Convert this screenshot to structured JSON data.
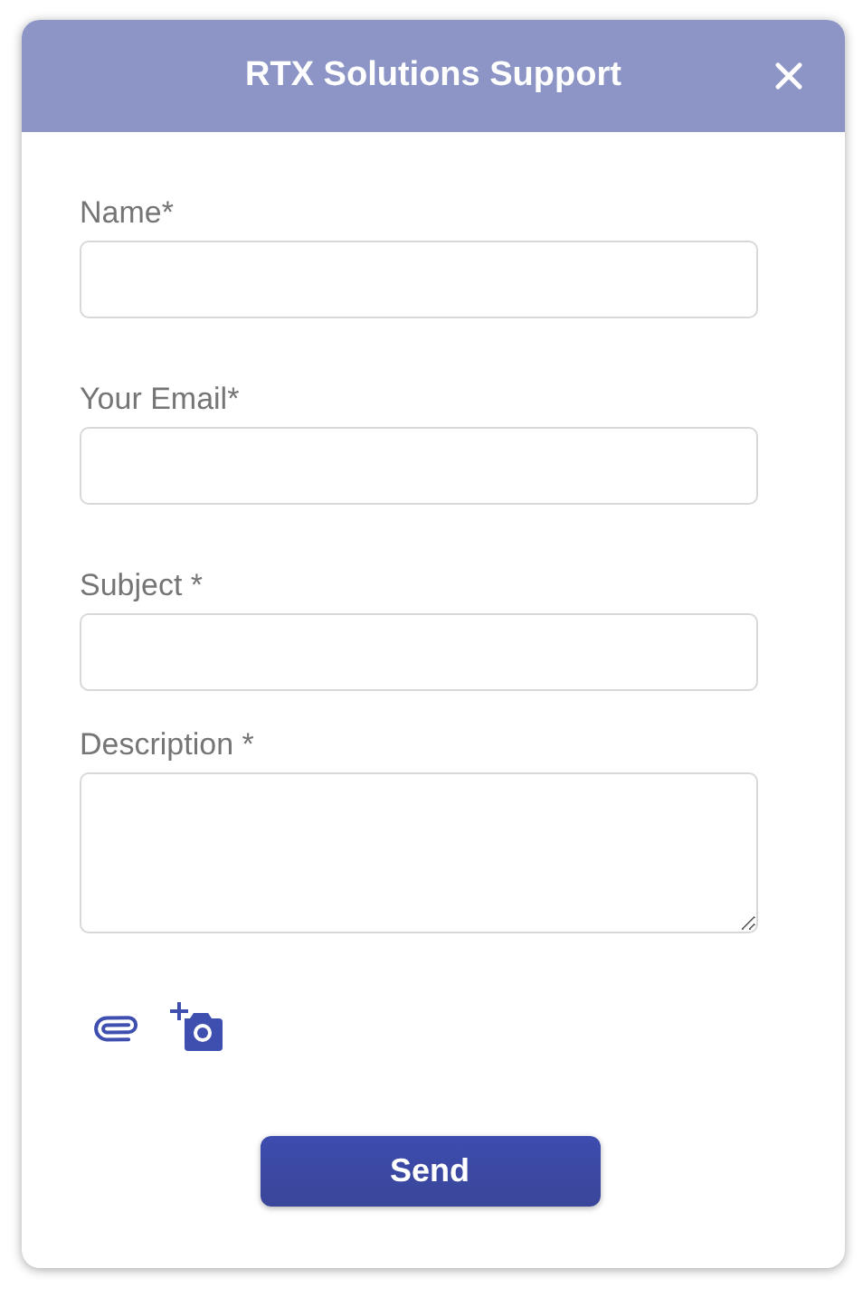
{
  "window": {
    "title": "RTX Solutions Support"
  },
  "fields": [
    {
      "label": "Name*",
      "kind": "input"
    },
    {
      "label": "Your Email*",
      "kind": "input"
    },
    {
      "label": "Subject *",
      "kind": "input"
    },
    {
      "label": "Description *",
      "kind": "textarea"
    }
  ],
  "buttons": [
    "Send"
  ]
}
